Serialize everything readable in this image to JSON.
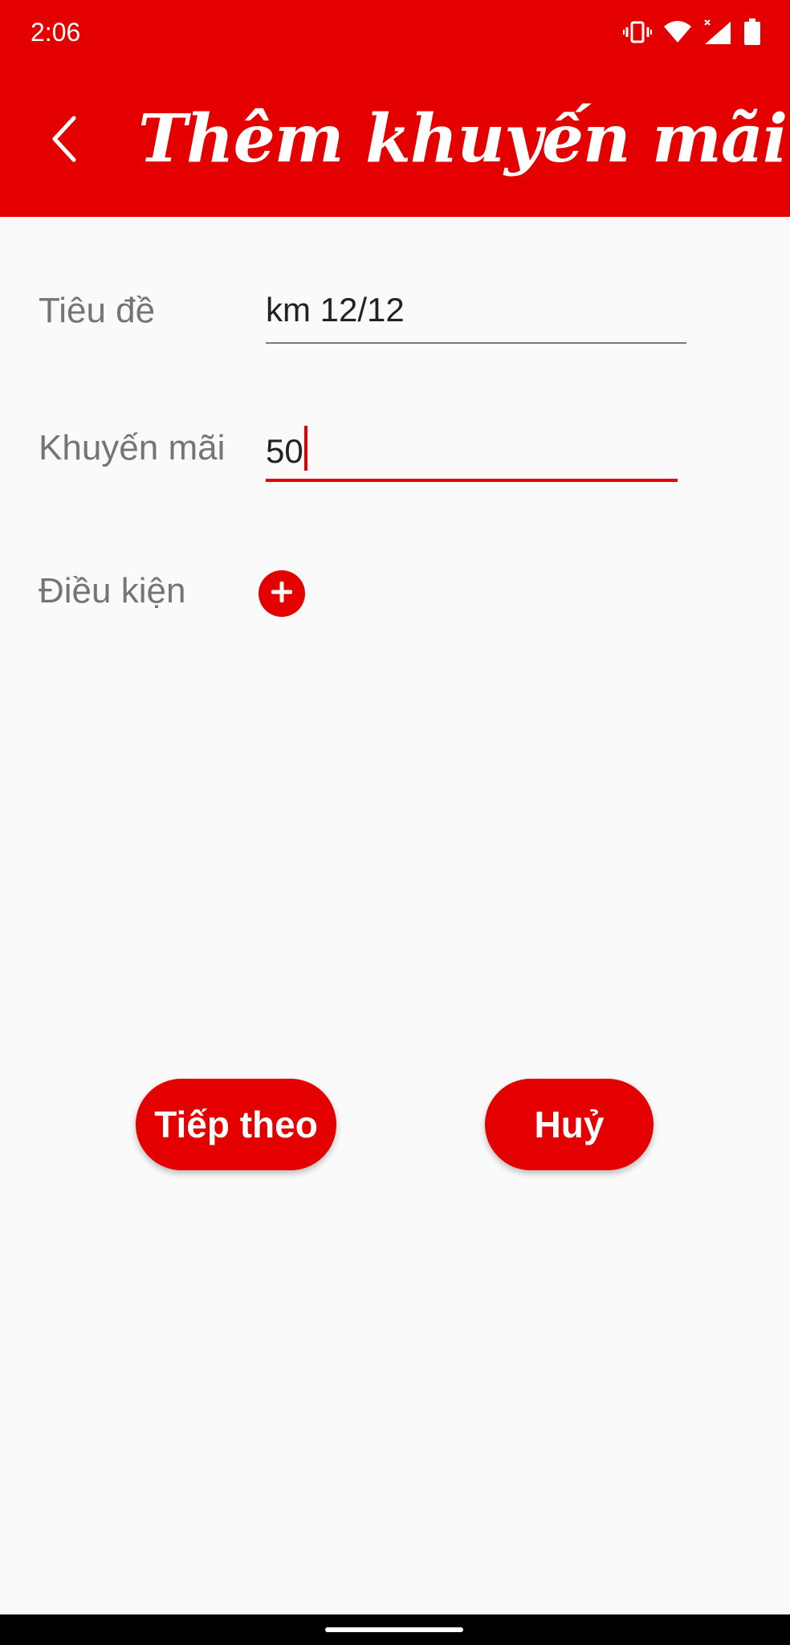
{
  "status_bar": {
    "time": "2:06",
    "icons": [
      "vibrate-icon",
      "wifi-icon",
      "signal-icon",
      "battery-icon"
    ]
  },
  "app_bar": {
    "title": "Thêm khuyến mãi",
    "back_icon": "chevron-left-icon",
    "color": "#e50000"
  },
  "form": {
    "title_label": "Tiêu đề",
    "title_value": "km 12/12",
    "discount_label": "Khuyến mãi",
    "discount_value": "50",
    "condition_label": "Điều kiện",
    "condition_add_icon": "plus-icon"
  },
  "actions": {
    "next_label": "Tiếp theo",
    "cancel_label": "Huỷ"
  },
  "colors": {
    "accent": "#e50000",
    "background": "#fafafa",
    "label": "#757575"
  }
}
